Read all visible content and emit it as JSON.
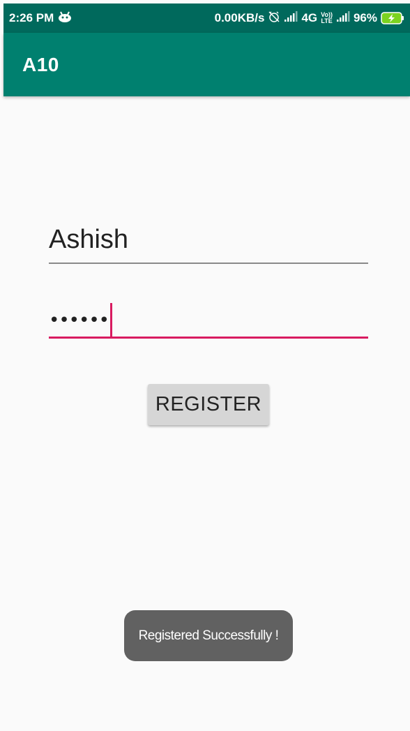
{
  "status_bar": {
    "time": "2:26 PM",
    "network_speed": "0.00KB/s",
    "network_type": "4G",
    "volte_top": "Vo))",
    "volte_bottom": "LTE",
    "battery_percent": "96%",
    "notification_icon": "android-debug-icon",
    "alarm_icon": "alarm-off-icon",
    "battery_icon": "battery-charging-icon"
  },
  "app_bar": {
    "title": "A10"
  },
  "form": {
    "username_value": "Ashish",
    "password_value": "••••••",
    "register_label": "REGISTER"
  },
  "toast": {
    "message": "Registered Successfully !"
  },
  "colors": {
    "status_bar": "#00695c",
    "app_bar": "#00806f",
    "accent": "#d81b60",
    "button": "#d6d6d6",
    "toast": "#616161",
    "background": "#fafafa"
  }
}
